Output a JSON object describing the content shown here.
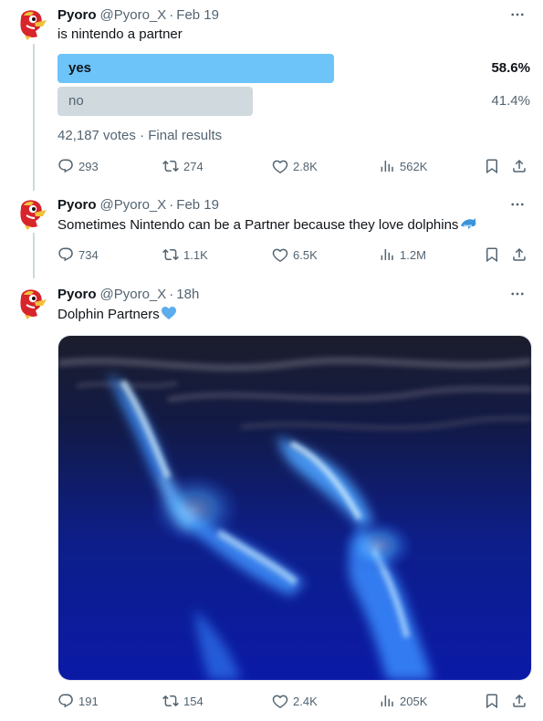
{
  "colors": {
    "poll_winner": "#6cc4f9",
    "poll_loser": "#cfd9de",
    "secondary_text": "#536471"
  },
  "tweets": [
    {
      "author": {
        "name": "Pyoro",
        "handle": "@Pyoro_X",
        "date": "Feb 19"
      },
      "text": "is nintendo a partner",
      "poll": {
        "options": [
          {
            "label": "yes",
            "percent": "58.6%",
            "fraction": 0.586,
            "winner": true
          },
          {
            "label": "no",
            "percent": "41.4%",
            "fraction": 0.414,
            "winner": false
          }
        ],
        "votes": "42,187 votes",
        "status": "Final results"
      },
      "stats": {
        "replies": "293",
        "reposts": "274",
        "likes": "2.8K",
        "views": "562K"
      }
    },
    {
      "author": {
        "name": "Pyoro",
        "handle": "@Pyoro_X",
        "date": "Feb 19"
      },
      "text": "Sometimes Nintendo can be a Partner because they love dolphins",
      "emoji_icon": "dolphin-emoji",
      "stats": {
        "replies": "734",
        "reposts": "1.1K",
        "likes": "6.5K",
        "views": "1.2M"
      }
    },
    {
      "author": {
        "name": "Pyoro",
        "handle": "@Pyoro_X",
        "date": "18h"
      },
      "text": "Dolphin Partners",
      "emoji_icon": "blue-heart-emoji",
      "media": "glowing-dolphins-image",
      "stats": {
        "replies": "191",
        "reposts": "154",
        "likes": "2.4K",
        "views": "205K"
      }
    }
  ],
  "icons": [
    "more-icon",
    "reply-icon",
    "repost-icon",
    "like-icon",
    "views-icon",
    "bookmark-icon",
    "share-icon"
  ]
}
